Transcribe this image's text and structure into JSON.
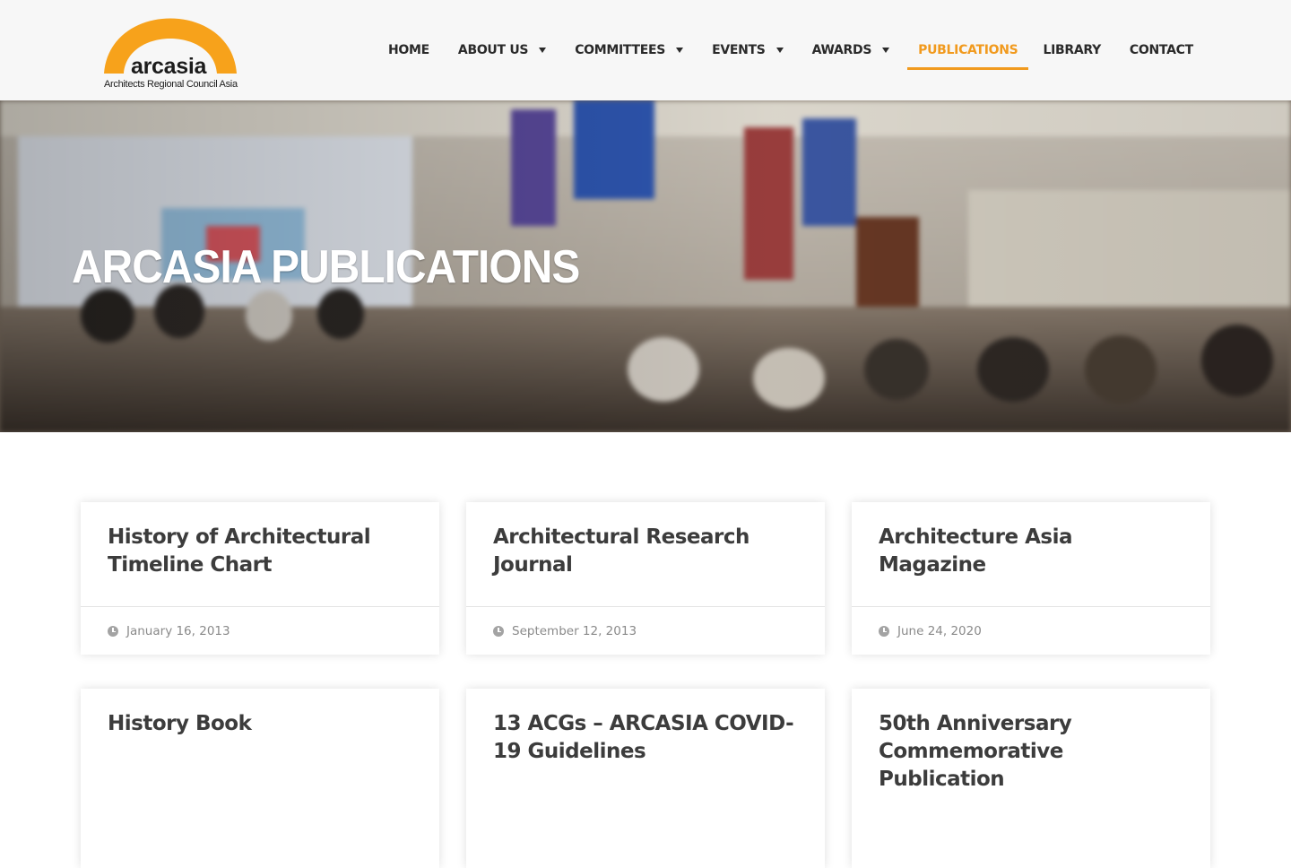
{
  "brand": {
    "name": "arcasia",
    "tagline": "Architects Regional Council Asia",
    "accent_color": "#f19a1e",
    "logo_icon": "arch-logo-icon"
  },
  "nav": {
    "items": [
      {
        "label": "HOME",
        "has_dropdown": false
      },
      {
        "label": "ABOUT US",
        "has_dropdown": true
      },
      {
        "label": "COMMITTEES",
        "has_dropdown": true
      },
      {
        "label": "EVENTS",
        "has_dropdown": true
      },
      {
        "label": "AWARDS",
        "has_dropdown": true
      },
      {
        "label": "PUBLICATIONS",
        "has_dropdown": false,
        "active": true
      },
      {
        "label": "LIBRARY",
        "has_dropdown": false
      },
      {
        "label": "CONTACT",
        "has_dropdown": false
      }
    ]
  },
  "hero": {
    "title": "ARCASIA PUBLICATIONS",
    "image": "conference-hall-photo"
  },
  "publications": [
    {
      "title": "History of Architectural Timeline Chart",
      "date": "January 16, 2013"
    },
    {
      "title": "Architectural Research Journal",
      "date": "September 12, 2013"
    },
    {
      "title": "Architecture Asia Magazine",
      "date": "June 24, 2020"
    },
    {
      "title": "History Book",
      "date": ""
    },
    {
      "title": "13 ACGs – ARCASIA COVID-19 Guidelines",
      "date": ""
    },
    {
      "title": "50th Anniversary Commemorative Publication",
      "date": ""
    }
  ]
}
